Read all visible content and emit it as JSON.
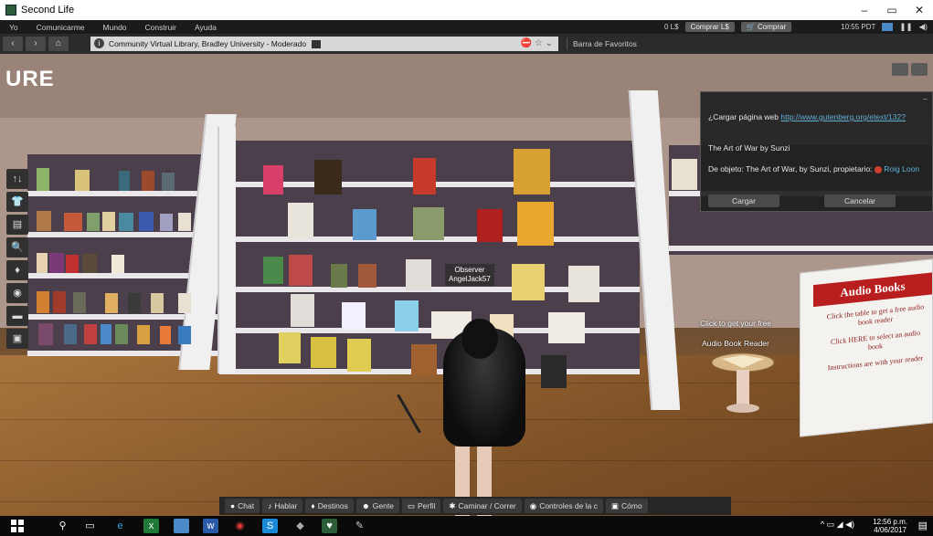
{
  "window": {
    "title": "Second Life",
    "minimize": "–",
    "maximize": "▭",
    "close": "✕"
  },
  "menubar": {
    "items": [
      "Yo",
      "Comunicarme",
      "Mundo",
      "Construir",
      "Ayuda"
    ],
    "balance": "0 L$",
    "buy_currency": "Comprar L$",
    "shop": "Comprar",
    "time": "10:55 PDT"
  },
  "navbar": {
    "back": "‹",
    "forward": "›",
    "home": "⌂",
    "location": "Community Virtual Library, Bradley University - Moderado",
    "favorites": "Barra de Favoritos"
  },
  "scene": {
    "logo": "URE",
    "nametag_line1": "Observer",
    "nametag_line2": "AngelJack57",
    "float_click": "Click to get your free",
    "float_reader": "Audio Book Reader",
    "sign_title": "Audio Books",
    "sign_text1": "Click the table to get a free audio book reader",
    "sign_text2": "Click HERE to select an audio book",
    "sign_text3": "Instructions are with your reader"
  },
  "dialog": {
    "prompt": "¿Cargar página web",
    "url": "http://www.gutenberg.org/etext/132?",
    "title": "The Art of War by Sunzi",
    "from_label": "De objeto: The Art of War, by Sunzi, propietario:",
    "owner": "Roig Loon",
    "load": "Cargar",
    "cancel": "Cancelar",
    "close": "–"
  },
  "lefttools": [
    "↑↓",
    "👕",
    "▤",
    "🔍",
    "♦",
    "◉",
    "▬",
    "▣"
  ],
  "bottombar": {
    "chat": "Chat",
    "talk": "Hablar",
    "destinations": "Destinos",
    "people": "Gente",
    "profile": "Perfil",
    "walk": "Caminar / Correr",
    "controls": "Controles de la c",
    "how": "Cómo"
  },
  "taskbar": {
    "time": "12:56 p.m.",
    "date": "4/06/2017",
    "tray": "^ ▭ ◢ ◀)",
    "notifications": "▤"
  },
  "colors": {
    "link": "#5fb0d8",
    "sign_red": "#b81e1e",
    "wall": "#ad968c",
    "floor": "#8a5f37",
    "shelf_back": "#4a3f4b"
  }
}
